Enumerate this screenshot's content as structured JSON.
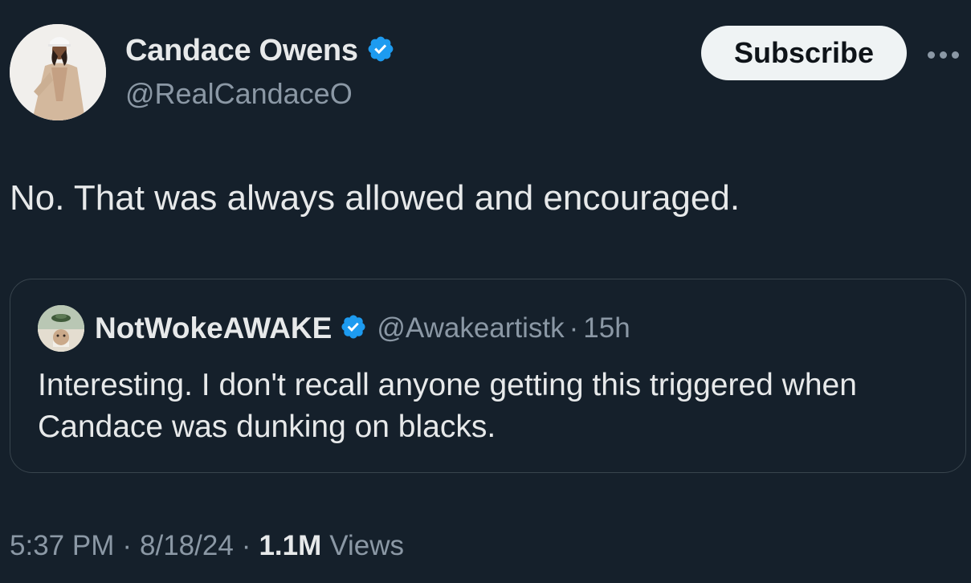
{
  "tweet": {
    "author_name": "Candace Owens",
    "author_handle": "@RealCandaceO",
    "text": "No. That was always allowed and encouraged.",
    "time": "5:37 PM",
    "date": "8/18/24",
    "views_count": "1.1M",
    "views_label": "Views",
    "separator": "·"
  },
  "header": {
    "subscribe_label": "Subscribe",
    "more_icon": "more-horizontal-icon"
  },
  "quote": {
    "author_name": "NotWokeAWAKE",
    "author_handle": "@Awakeartistk",
    "separator": "·",
    "time": "15h",
    "text": "Interesting.  I don't recall anyone getting this triggered when Candace was dunking on blacks."
  },
  "colors": {
    "background": "#15202b",
    "primary_text": "#e7e9ea",
    "secondary_text": "#8b98a5",
    "verified_badge": "#1d9bf0",
    "subscribe_bg": "#eff3f4",
    "border": "#38444d"
  }
}
